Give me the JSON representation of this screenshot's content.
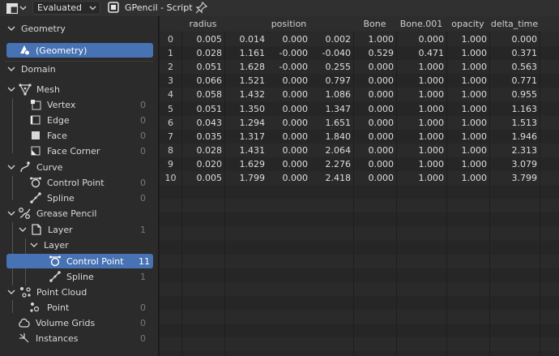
{
  "header": {
    "mode_label": "Evaluated",
    "object_name": "GPencil -  Script"
  },
  "sidebar": {
    "geometry_label": "Geometry",
    "geometry_item": "(Geometry)",
    "domain_label": "Domain",
    "items": [
      {
        "label": "Mesh",
        "count": ""
      },
      {
        "label": "Vertex",
        "count": "0"
      },
      {
        "label": "Edge",
        "count": "0"
      },
      {
        "label": "Face",
        "count": "0"
      },
      {
        "label": "Face Corner",
        "count": "0"
      },
      {
        "label": "Curve",
        "count": ""
      },
      {
        "label": "Control Point",
        "count": "0"
      },
      {
        "label": "Spline",
        "count": "0"
      },
      {
        "label": "Grease Pencil",
        "count": ""
      },
      {
        "label": "Layer",
        "count": "1"
      },
      {
        "label": "Layer",
        "count": ""
      },
      {
        "label": "Control Point",
        "count": "11"
      },
      {
        "label": "Spline",
        "count": "1"
      },
      {
        "label": "Point Cloud",
        "count": ""
      },
      {
        "label": "Point",
        "count": "0"
      },
      {
        "label": "Volume Grids",
        "count": "0"
      },
      {
        "label": "Instances",
        "count": "0"
      }
    ]
  },
  "table": {
    "columns": [
      "radius",
      "position",
      "Bone",
      "Bone.001",
      "opacity",
      "delta_time"
    ],
    "rows": [
      [
        "0",
        "0.005",
        "0.014",
        "0.000",
        "0.002",
        "1.000",
        "0.000",
        "1.000",
        "0.000"
      ],
      [
        "1",
        "0.028",
        "1.161",
        "-0.000",
        "-0.040",
        "0.529",
        "0.471",
        "1.000",
        "0.371"
      ],
      [
        "2",
        "0.051",
        "1.628",
        "-0.000",
        "0.255",
        "0.000",
        "1.000",
        "1.000",
        "0.563"
      ],
      [
        "3",
        "0.066",
        "1.521",
        "0.000",
        "0.797",
        "0.000",
        "1.000",
        "1.000",
        "0.771"
      ],
      [
        "4",
        "0.058",
        "1.432",
        "0.000",
        "1.086",
        "0.000",
        "1.000",
        "1.000",
        "0.955"
      ],
      [
        "5",
        "0.051",
        "1.350",
        "0.000",
        "1.347",
        "0.000",
        "1.000",
        "1.000",
        "1.163"
      ],
      [
        "6",
        "0.043",
        "1.294",
        "0.000",
        "1.651",
        "0.000",
        "1.000",
        "1.000",
        "1.513"
      ],
      [
        "7",
        "0.035",
        "1.317",
        "0.000",
        "1.840",
        "0.000",
        "1.000",
        "1.000",
        "1.946"
      ],
      [
        "8",
        "0.028",
        "1.431",
        "0.000",
        "2.064",
        "0.000",
        "1.000",
        "1.000",
        "2.313"
      ],
      [
        "9",
        "0.020",
        "1.629",
        "0.000",
        "2.276",
        "0.000",
        "1.000",
        "1.000",
        "3.079"
      ],
      [
        "10",
        "0.005",
        "1.799",
        "0.000",
        "2.418",
        "0.000",
        "1.000",
        "1.000",
        "3.799"
      ]
    ]
  },
  "colors": {
    "selection": "#4772b3",
    "panel": "#2b2b2b",
    "table_bg": "#282828"
  }
}
